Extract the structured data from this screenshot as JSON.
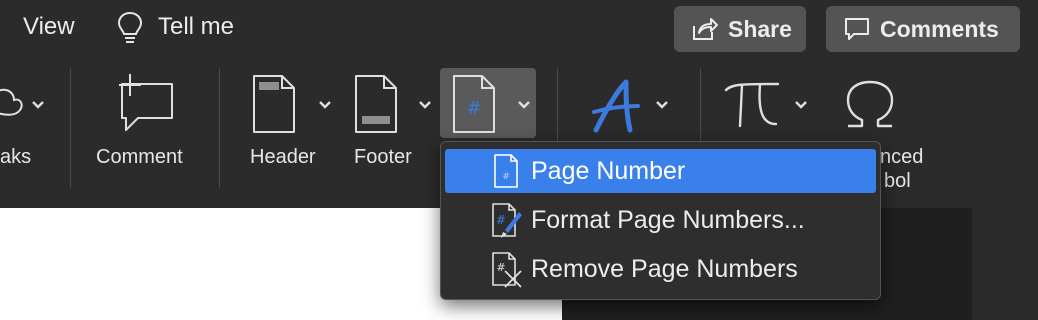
{
  "menubar": {
    "view": "View",
    "tell_me": "Tell me"
  },
  "actions": {
    "share": "Share",
    "comments": "Comments"
  },
  "ribbon": {
    "partial_left": "aks",
    "comment": "Comment",
    "header": "Header",
    "footer": "Footer",
    "advanced_symbol_line1": "nced",
    "advanced_symbol_line2": "bol"
  },
  "dropdown": {
    "items": [
      {
        "label": "Page Number",
        "icon": "page-number-icon",
        "selected": true
      },
      {
        "label": "Format Page Numbers...",
        "icon": "format-page-numbers-icon",
        "selected": false
      },
      {
        "label": "Remove Page Numbers",
        "icon": "remove-page-numbers-icon",
        "selected": false
      }
    ]
  },
  "colors": {
    "background": "#2b2b2b",
    "button_fill": "#545454",
    "highlight": "#3a80ea",
    "accent_icon": "#3b7be0"
  }
}
